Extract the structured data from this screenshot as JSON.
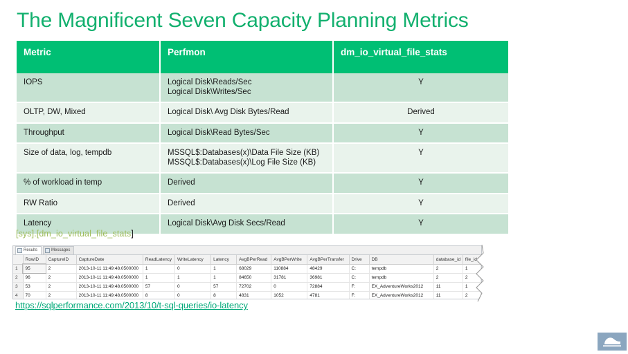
{
  "slide": {
    "title": "The Magnificent Seven Capacity Planning Metrics",
    "title_color": "#12b06e"
  },
  "table": {
    "headers": {
      "metric": "Metric",
      "perfmon": "Perfmon",
      "dmv": "dm_io_virtual_file_stats"
    },
    "header_bg": "#00bf74",
    "band_dark": "#c6e2d2",
    "band_light": "#e9f3ec",
    "rows": [
      {
        "metric": "IOPS",
        "perfmon_line1": "Logical Disk\\Reads/Sec",
        "perfmon_line2": "Logical Disk\\Writes/Sec",
        "dmv": "Y"
      },
      {
        "metric": "OLTP, DW, Mixed",
        "perfmon_line1": "Logical Disk\\ Avg Disk Bytes/Read",
        "perfmon_line2": "",
        "dmv": "Derived"
      },
      {
        "metric": "Throughput",
        "perfmon_line1": "Logical Disk\\Read Bytes/Sec",
        "perfmon_line2": "",
        "dmv": "Y"
      },
      {
        "metric": "Size of data, log, tempdb",
        "perfmon_line1": "MSSQL$:Databases(x)\\Data File Size (KB)",
        "perfmon_line2": "MSSQL$:Databases(x)\\Log File Size (KB)",
        "dmv": "Y"
      },
      {
        "metric": "% of workload in temp",
        "perfmon_line1": "Derived",
        "perfmon_line2": "",
        "dmv": "Y"
      },
      {
        "metric": "RW Ratio",
        "perfmon_line1": "Derived",
        "perfmon_line2": "",
        "dmv": "Y"
      },
      {
        "metric": "Latency",
        "perfmon_line1": "Logical Disk\\Avg Disk Secs/Read",
        "perfmon_line2": "",
        "dmv": "Y"
      }
    ]
  },
  "caption": {
    "head": "[sys].[dm_io_virtual_file_stats",
    "tail": "]",
    "color": "#9fbc5c"
  },
  "ssms": {
    "tabs": [
      {
        "label": "Results",
        "active": true
      },
      {
        "label": "Messages",
        "active": false
      }
    ],
    "columns": [
      "",
      "RowID",
      "CaptureID",
      "CaptureDate",
      "ReadLatency",
      "WriteLatency",
      "Latency",
      "AvgBPerRead",
      "AvgBPerWrite",
      "AvgBPerTransfer",
      "Drive",
      "DB",
      "database_id",
      "file_id"
    ],
    "rows": [
      {
        "num": "1",
        "rowid": "95",
        "captureid": "2",
        "capturedate": "2013-10-11 11:49:48.0500000",
        "readlatency": "1",
        "writelatency": "0",
        "latency": "1",
        "avgbperread": "68029",
        "avgbperwrite": "110884",
        "avgbpertransfer": "48429",
        "drive": "C:",
        "db": "tempdb",
        "database_id": "2",
        "file_id": "1"
      },
      {
        "num": "2",
        "rowid": "96",
        "captureid": "2",
        "capturedate": "2013-10-11 11:49:48.0500000",
        "readlatency": "1",
        "writelatency": "1",
        "latency": "1",
        "avgbperread": "84650",
        "avgbperwrite": "31781",
        "avgbpertransfer": "36981",
        "drive": "C:",
        "db": "tempdb",
        "database_id": "2",
        "file_id": "2"
      },
      {
        "num": "3",
        "rowid": "53",
        "captureid": "2",
        "capturedate": "2013-10-11 11:49:48.0500000",
        "readlatency": "57",
        "writelatency": "0",
        "latency": "57",
        "avgbperread": "72702",
        "avgbperwrite": "0",
        "avgbpertransfer": "72884",
        "drive": "F:",
        "db": "EX_AdventureWorks2012",
        "database_id": "11",
        "file_id": "1"
      },
      {
        "num": "4",
        "rowid": "70",
        "captureid": "2",
        "capturedate": "2013-10-11 11:49:48.0500000",
        "readlatency": "8",
        "writelatency": "0",
        "latency": "8",
        "avgbperread": "4831",
        "avgbperwrite": "1052",
        "avgbpertransfer": "4781",
        "drive": "F:",
        "db": "EX_AdventureWorks2012",
        "database_id": "11",
        "file_id": "2"
      }
    ]
  },
  "link": {
    "url": "https://sqlperformance.com/2013/10/t-sql-queries/io-latency",
    "color": "#00a878"
  },
  "logo": {
    "name": "corner-logo",
    "color": "#8ba6bf"
  }
}
